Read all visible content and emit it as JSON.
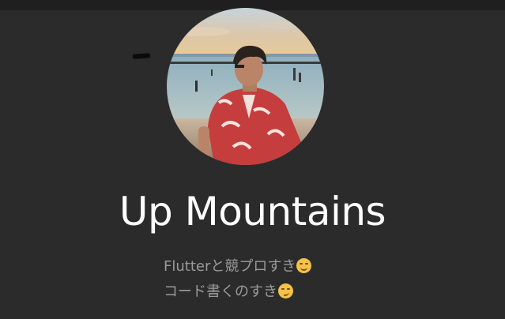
{
  "profile": {
    "name": "Up Mountains",
    "bio_line_1": "Flutterと競プロすき",
    "bio_line_2": "コード書くのすき",
    "bio_line_1_emoji": "smiling-face-icon",
    "bio_line_2_emoji": "smirking-face-icon"
  },
  "colors": {
    "background": "#2b2b2b",
    "top_bar": "#1f1f1f",
    "name_text": "#ffffff",
    "bio_text": "#9a9a9a"
  }
}
